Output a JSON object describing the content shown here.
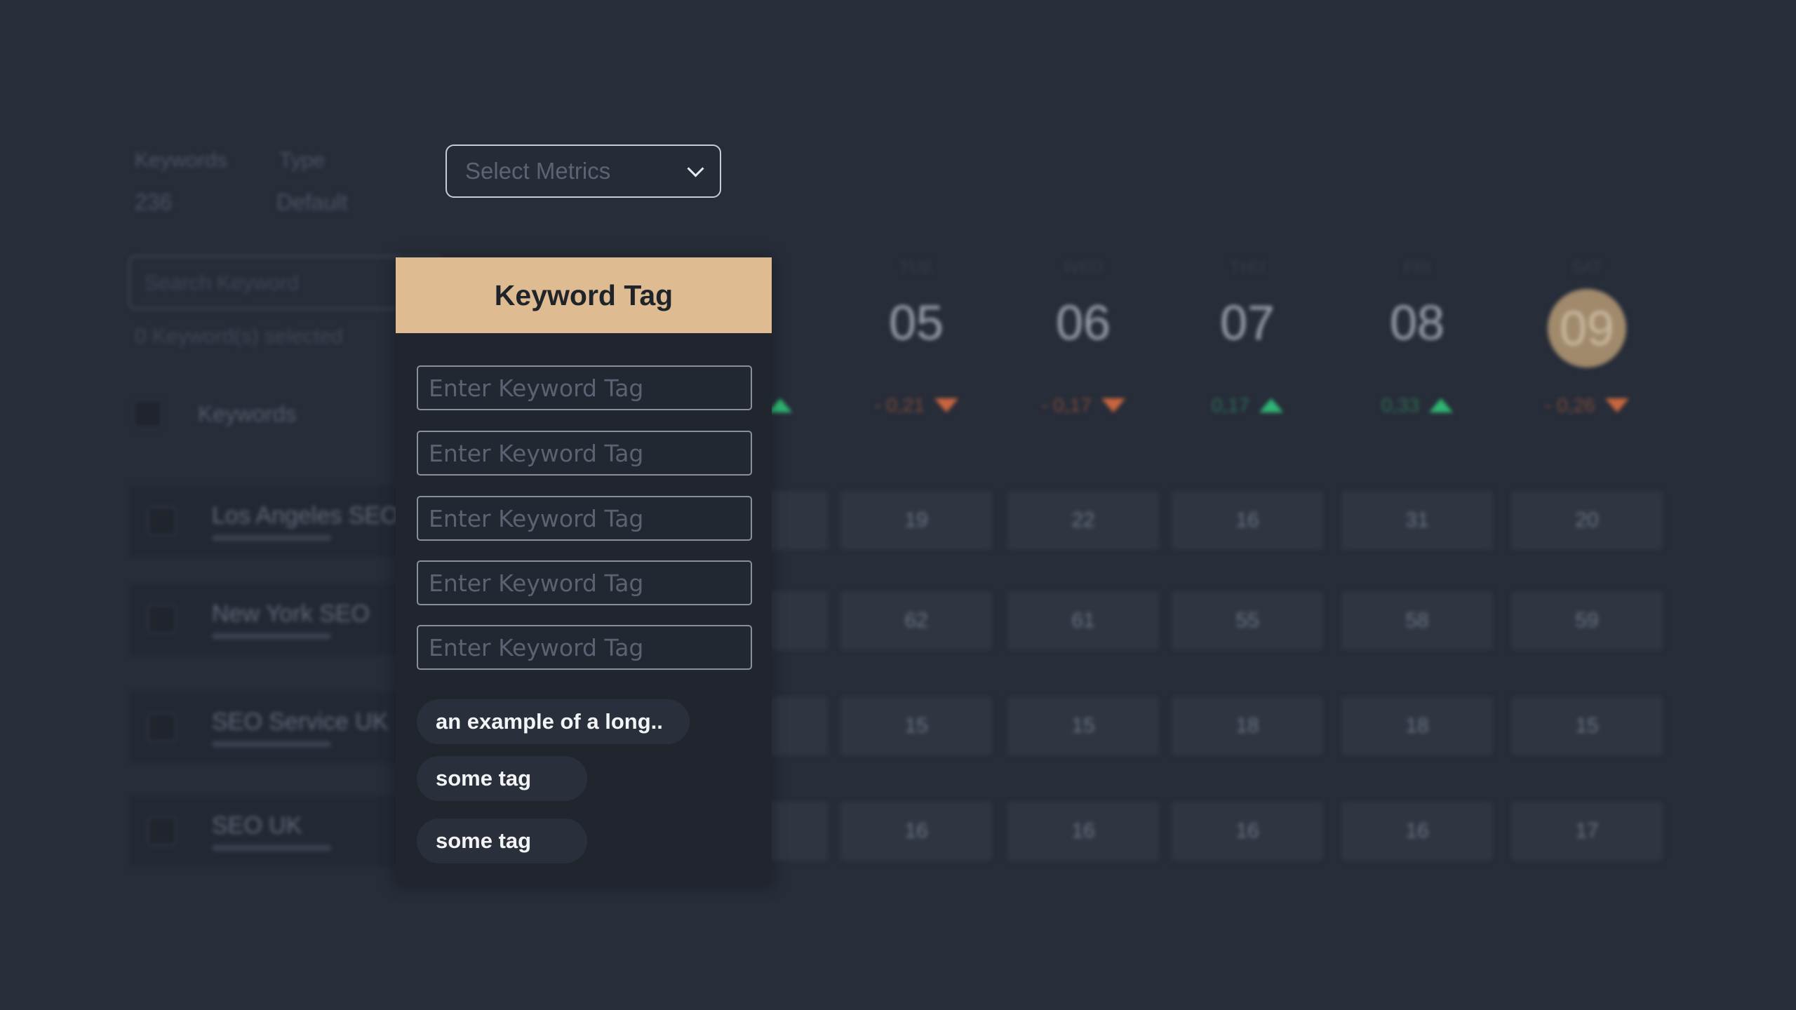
{
  "header": {
    "keywords_label": "Keywords",
    "keywords_count": "236",
    "type_label": "Type",
    "type_value": "Default",
    "metrics_select": {
      "placeholder": "Select Metrics"
    }
  },
  "sidebar": {
    "search_placeholder": "Search Keyword",
    "selected_text": "0 Keyword(s) selected",
    "column_header": "Keywords",
    "keywords": [
      {
        "name": "Los Angeles SEO"
      },
      {
        "name": "New York SEO"
      },
      {
        "name": "SEO Service UK"
      },
      {
        "name": "SEO UK"
      }
    ]
  },
  "calendar": {
    "days": [
      {
        "name": "TUE",
        "num": "05",
        "delta": "- 0,21",
        "trend": "down"
      },
      {
        "name": "WED",
        "num": "06",
        "delta": "- 0,17",
        "trend": "down"
      },
      {
        "name": "THU",
        "num": "07",
        "delta": "0,17",
        "trend": "up"
      },
      {
        "name": "FRI",
        "num": "08",
        "delta": "0,33",
        "trend": "up"
      },
      {
        "name": "SAT",
        "num": "09",
        "delta": "- 0,26",
        "trend": "down",
        "selected": true
      }
    ],
    "rows": [
      [
        "19",
        "22",
        "16",
        "31",
        "20"
      ],
      [
        "62",
        "61",
        "55",
        "58",
        "59"
      ],
      [
        "15",
        "15",
        "18",
        "18",
        "15"
      ],
      [
        "16",
        "16",
        "16",
        "16",
        "17"
      ]
    ],
    "colors": {
      "up": "#2fb673",
      "down": "#c8663f",
      "selected_day": "#a18a6c"
    }
  },
  "popup": {
    "title": "Keyword Tag",
    "accent": "#dfbb92",
    "inputs": [
      {
        "placeholder": "Enter Keyword Tag",
        "value": ""
      },
      {
        "placeholder": "Enter Keyword Tag",
        "value": ""
      },
      {
        "placeholder": "Enter Keyword Tag",
        "value": ""
      },
      {
        "placeholder": "Enter Keyword Tag",
        "value": ""
      },
      {
        "placeholder": "Enter Keyword Tag",
        "value": ""
      }
    ],
    "tags": [
      {
        "label": "an example of a long.."
      },
      {
        "label": "some tag"
      },
      {
        "label": "some tag"
      }
    ]
  }
}
